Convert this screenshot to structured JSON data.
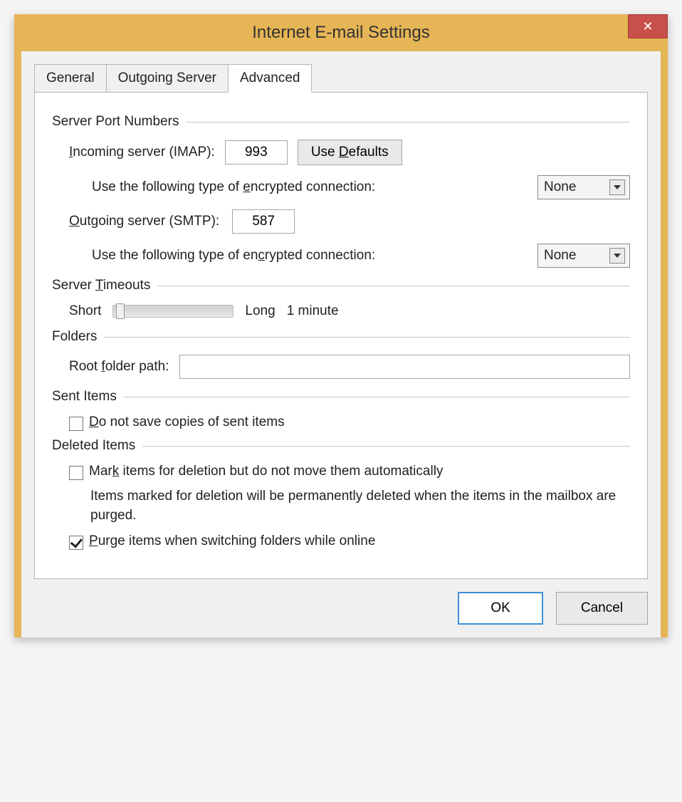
{
  "title": "Internet E-mail Settings",
  "close_label": "✕",
  "tabs": {
    "general": "General",
    "outgoing": "Outgoing Server",
    "advanced": "Advanced"
  },
  "groups": {
    "server_ports": "Server Port Numbers",
    "server_timeouts": "Server Timeouts",
    "folders": "Folders",
    "sent_items": "Sent Items",
    "deleted_items": "Deleted Items"
  },
  "fields": {
    "incoming_label": "Incoming server (IMAP):",
    "incoming_value": "993",
    "use_defaults_label": "Use Defaults",
    "encryption_label": "Use the following type of encrypted connection:",
    "encryption_in_value": "None",
    "outgoing_label": "Outgoing server (SMTP):",
    "outgoing_value": "587",
    "encryption_out_value": "None",
    "timeout_short": "Short",
    "timeout_long": "Long",
    "timeout_value": "1 minute",
    "root_folder_label": "Root folder path:",
    "root_folder_value": ""
  },
  "checkboxes": {
    "dont_save_sent": "Do not save copies of sent items",
    "mark_for_deletion": "Mark items for deletion but do not move them automatically",
    "mark_helper": "Items marked for deletion will be permanently deleted when the items in the mailbox are purged.",
    "purge": "Purge items when switching folders while online"
  },
  "buttons": {
    "ok": "OK",
    "cancel": "Cancel"
  }
}
